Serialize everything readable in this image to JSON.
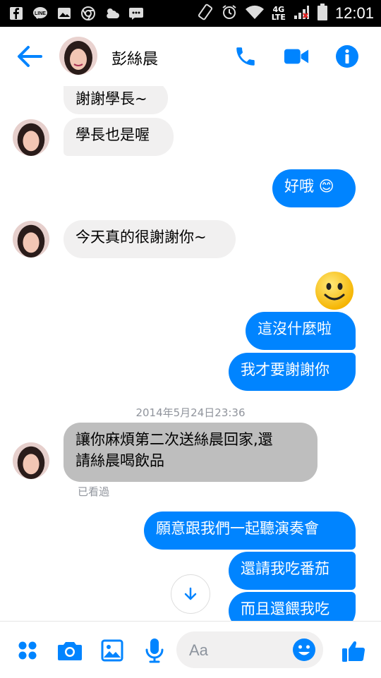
{
  "status_bar": {
    "time": "12:01",
    "network_line1": "4G",
    "network_line2": "LTE",
    "icons_left": [
      "facebook-icon",
      "line-icon",
      "gallery-icon",
      "chrome-icon",
      "weather-icon",
      "messenger-icon"
    ],
    "icons_right": [
      "screen-rotate-icon",
      "alarm-icon",
      "wifi-icon",
      "signal-icon",
      "battery-icon"
    ]
  },
  "header": {
    "contact_name": "彭絲晨",
    "accent": "#0084ff"
  },
  "messages": [
    {
      "dir": "in",
      "text": "謝謝學長~"
    },
    {
      "dir": "in",
      "text": "學長也是喔"
    },
    {
      "dir": "out",
      "text": "好哦",
      "emoji": "😊"
    },
    {
      "dir": "in",
      "text": "今天真的很謝謝你~"
    },
    {
      "dir": "out",
      "type": "emoji",
      "emoji": "smiley-face"
    },
    {
      "dir": "out",
      "text": "這沒什麼啦"
    },
    {
      "dir": "out",
      "text": "我才要謝謝你"
    },
    {
      "dir": "in",
      "text_line1": "讓你麻煩第二次送絲晨回家,還",
      "text_line2": "請絲晨喝飲品"
    },
    {
      "dir": "out",
      "text": "願意跟我們一起聽演奏會"
    },
    {
      "dir": "out",
      "text": "還請我吃番茄"
    },
    {
      "dir": "out",
      "text": "而且還餵我吃"
    }
  ],
  "timestamp": "2014年5月24日23:36",
  "seen_label": "已看過",
  "composer": {
    "placeholder": "Aa"
  },
  "colors": {
    "outgoing_bubble": "#0084ff",
    "incoming_bubble": "#f1f0f0",
    "incoming_bubble_highlighted": "#bebebe"
  }
}
